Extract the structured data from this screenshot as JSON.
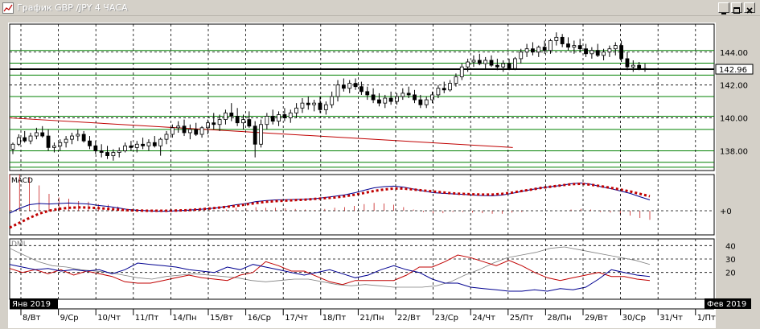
{
  "window": {
    "title": "График GBP /JPY  4 ЧАСА"
  },
  "colors": {
    "background": "#ffffff",
    "frame": "#d4d0c8",
    "grid": "#000000",
    "level": "#008000",
    "trendline": "#c00000",
    "macd_line": "#000090",
    "signal": "#c00000",
    "di_plus": "#000090",
    "di_minus": "#c00000",
    "adx": "#808080",
    "price_tag_bg": "#ffffff"
  },
  "chart_data": [
    {
      "type": "candlestick",
      "title": "GBP/JPY 4H",
      "ylim": [
        136.8,
        145.7
      ],
      "y_ticks": [
        "144.00",
        "142.00",
        "140.00",
        "138.00"
      ],
      "current_price_label": "142.96",
      "levels": [
        144.1,
        143.33,
        142.96,
        142.6,
        141.3,
        140.1,
        139.3,
        138.0,
        137.3,
        137.0
      ],
      "trendline": [
        [
          0,
          140.0
        ],
        [
          87,
          138.2
        ]
      ],
      "ohlc": [
        [
          138.1,
          138.5,
          137.8,
          138.4
        ],
        [
          138.4,
          139.0,
          138.3,
          138.8
        ],
        [
          138.8,
          139.2,
          138.5,
          138.6
        ],
        [
          138.6,
          139.1,
          138.4,
          138.9
        ],
        [
          138.9,
          139.4,
          138.7,
          139.1
        ],
        [
          139.1,
          139.5,
          138.8,
          138.9
        ],
        [
          138.9,
          139.3,
          138.0,
          138.2
        ],
        [
          138.2,
          138.5,
          137.9,
          138.3
        ],
        [
          138.3,
          138.7,
          138.0,
          138.5
        ],
        [
          138.5,
          138.9,
          138.2,
          138.7
        ],
        [
          138.7,
          139.1,
          138.4,
          138.9
        ],
        [
          138.9,
          139.3,
          138.6,
          139.0
        ],
        [
          139.0,
          139.2,
          138.5,
          138.6
        ],
        [
          138.6,
          138.9,
          138.1,
          138.3
        ],
        [
          138.3,
          138.6,
          137.8,
          138.0
        ],
        [
          138.0,
          138.4,
          137.6,
          137.9
        ],
        [
          137.9,
          138.3,
          137.5,
          137.7
        ],
        [
          137.7,
          138.1,
          137.4,
          137.9
        ],
        [
          137.9,
          138.2,
          137.6,
          138.0
        ],
        [
          138.0,
          138.5,
          137.9,
          138.3
        ],
        [
          138.3,
          138.6,
          138.0,
          138.2
        ],
        [
          138.2,
          138.6,
          137.9,
          138.4
        ],
        [
          138.4,
          138.8,
          138.1,
          138.3
        ],
        [
          138.3,
          138.7,
          138.0,
          138.5
        ],
        [
          138.5,
          138.9,
          138.2,
          138.3
        ],
        [
          138.3,
          138.8,
          137.7,
          138.7
        ],
        [
          138.7,
          139.2,
          138.4,
          139.0
        ],
        [
          139.0,
          139.6,
          138.8,
          139.4
        ],
        [
          139.4,
          139.8,
          139.1,
          139.5
        ],
        [
          139.5,
          139.9,
          138.9,
          139.1
        ],
        [
          139.1,
          139.6,
          138.7,
          139.3
        ],
        [
          139.3,
          139.7,
          138.9,
          139.0
        ],
        [
          139.0,
          139.5,
          138.8,
          139.4
        ],
        [
          139.4,
          139.9,
          139.0,
          139.7
        ],
        [
          139.7,
          140.3,
          139.3,
          139.6
        ],
        [
          139.6,
          140.2,
          139.2,
          139.9
        ],
        [
          139.9,
          140.5,
          139.6,
          140.3
        ],
        [
          140.3,
          140.9,
          139.8,
          140.1
        ],
        [
          140.1,
          140.6,
          139.5,
          139.7
        ],
        [
          139.7,
          140.2,
          139.3,
          139.9
        ],
        [
          139.9,
          140.4,
          139.4,
          139.5
        ],
        [
          139.5,
          139.8,
          137.6,
          138.4
        ],
        [
          138.4,
          139.9,
          138.2,
          139.6
        ],
        [
          139.6,
          140.3,
          139.3,
          140.1
        ],
        [
          140.1,
          140.5,
          139.6,
          139.8
        ],
        [
          139.8,
          140.4,
          139.5,
          140.2
        ],
        [
          140.2,
          140.6,
          139.8,
          140.0
        ],
        [
          140.0,
          140.5,
          139.7,
          140.3
        ],
        [
          140.3,
          140.9,
          140.0,
          140.6
        ],
        [
          140.6,
          141.2,
          140.3,
          140.9
        ],
        [
          140.9,
          141.3,
          140.5,
          140.8
        ],
        [
          140.8,
          141.1,
          140.4,
          140.9
        ],
        [
          140.9,
          141.3,
          140.3,
          140.5
        ],
        [
          140.5,
          141.0,
          140.2,
          140.8
        ],
        [
          140.8,
          141.6,
          140.6,
          141.3
        ],
        [
          141.3,
          142.3,
          141.0,
          142.0
        ],
        [
          142.0,
          142.4,
          141.6,
          141.8
        ],
        [
          141.8,
          142.3,
          141.5,
          142.1
        ],
        [
          142.1,
          142.4,
          141.7,
          141.9
        ],
        [
          141.9,
          142.2,
          141.4,
          141.6
        ],
        [
          141.6,
          141.9,
          141.1,
          141.4
        ],
        [
          141.4,
          141.8,
          140.9,
          141.1
        ],
        [
          141.1,
          141.5,
          140.7,
          140.9
        ],
        [
          140.9,
          141.4,
          140.6,
          141.2
        ],
        [
          141.2,
          141.6,
          140.8,
          141.0
        ],
        [
          141.0,
          141.5,
          140.8,
          141.3
        ],
        [
          141.3,
          141.8,
          141.1,
          141.5
        ],
        [
          141.5,
          141.9,
          141.2,
          141.4
        ],
        [
          141.4,
          141.7,
          140.9,
          141.1
        ],
        [
          141.1,
          141.4,
          140.6,
          140.8
        ],
        [
          140.8,
          141.3,
          140.6,
          141.1
        ],
        [
          141.1,
          141.6,
          140.9,
          141.4
        ],
        [
          141.4,
          142.0,
          141.2,
          141.8
        ],
        [
          141.8,
          142.2,
          141.5,
          141.7
        ],
        [
          141.7,
          142.3,
          141.6,
          142.1
        ],
        [
          142.1,
          142.7,
          141.9,
          142.5
        ],
        [
          142.5,
          143.3,
          142.3,
          143.1
        ],
        [
          143.1,
          143.6,
          142.8,
          143.4
        ],
        [
          143.4,
          143.8,
          143.1,
          143.5
        ],
        [
          143.5,
          143.9,
          143.2,
          143.3
        ],
        [
          143.3,
          143.7,
          143.0,
          143.5
        ],
        [
          143.5,
          143.8,
          143.1,
          143.2
        ],
        [
          143.2,
          143.6,
          142.9,
          143.1
        ],
        [
          143.1,
          143.5,
          142.8,
          143.3
        ],
        [
          143.3,
          143.6,
          142.9,
          143.0
        ],
        [
          143.0,
          143.7,
          142.9,
          143.6
        ],
        [
          143.6,
          144.2,
          143.3,
          144.0
        ],
        [
          144.0,
          144.5,
          143.7,
          144.2
        ],
        [
          144.2,
          144.6,
          143.8,
          144.0
        ],
        [
          144.0,
          144.4,
          143.7,
          144.3
        ],
        [
          144.3,
          144.7,
          143.9,
          144.1
        ],
        [
          144.1,
          144.8,
          143.9,
          144.7
        ],
        [
          144.7,
          145.2,
          144.4,
          144.9
        ],
        [
          144.9,
          145.1,
          144.3,
          144.5
        ],
        [
          144.5,
          144.9,
          144.1,
          144.3
        ],
        [
          144.3,
          144.7,
          143.9,
          144.4
        ],
        [
          144.4,
          144.8,
          144.0,
          144.2
        ],
        [
          144.2,
          144.5,
          143.7,
          143.9
        ],
        [
          143.9,
          144.3,
          143.6,
          144.1
        ],
        [
          144.1,
          144.5,
          143.7,
          143.8
        ],
        [
          143.8,
          144.2,
          143.5,
          144.0
        ],
        [
          144.0,
          144.4,
          143.7,
          144.2
        ],
        [
          144.2,
          144.6,
          143.8,
          144.4
        ],
        [
          144.4,
          144.7,
          143.4,
          143.6
        ],
        [
          143.6,
          144.0,
          142.9,
          143.1
        ],
        [
          143.1,
          143.5,
          142.8,
          143.2
        ],
        [
          143.2,
          143.4,
          142.9,
          143.0
        ],
        [
          143.0,
          143.3,
          142.8,
          142.96
        ]
      ]
    },
    {
      "type": "line",
      "title": "MACD",
      "y_tick": "+0",
      "ylim": [
        -1.0,
        1.5
      ],
      "series": [
        {
          "values": [
            -0.1,
            0.1,
            0.25,
            0.3,
            0.28,
            0.3,
            0.32,
            0.3,
            0.28,
            0.22,
            0.18,
            0.12,
            0.05,
            0.02,
            0.0,
            -0.02,
            -0.02,
            0.0,
            0.02,
            0.05,
            0.08,
            0.12,
            0.18,
            0.25,
            0.3,
            0.38,
            0.42,
            0.45,
            0.46,
            0.47,
            0.48,
            0.5,
            0.55,
            0.6,
            0.66,
            0.74,
            0.85,
            0.95,
            1.0,
            1.02,
            0.98,
            0.9,
            0.82,
            0.75,
            0.72,
            0.7,
            0.68,
            0.65,
            0.63,
            0.62,
            0.65,
            0.72,
            0.8,
            0.88,
            0.95,
            1.0,
            1.05,
            1.12,
            1.15,
            1.1,
            1.0,
            0.92,
            0.82,
            0.72,
            0.58,
            0.45
          ]
        },
        {
          "values": [
            -0.7,
            -0.5,
            -0.3,
            -0.12,
            0.0,
            0.08,
            0.12,
            0.14,
            0.13,
            0.11,
            0.08,
            0.05,
            0.02,
            0.01,
            0.0,
            0.0,
            0.0,
            0.01,
            0.02,
            0.05,
            0.08,
            0.12,
            0.16,
            0.2,
            0.26,
            0.32,
            0.37,
            0.4,
            0.42,
            0.44,
            0.46,
            0.49,
            0.52,
            0.55,
            0.6,
            0.66,
            0.74,
            0.82,
            0.88,
            0.92,
            0.92,
            0.88,
            0.84,
            0.8,
            0.76,
            0.72,
            0.7,
            0.68,
            0.67,
            0.67,
            0.7,
            0.75,
            0.82,
            0.88,
            0.95,
            1.0,
            1.05,
            1.1,
            1.12,
            1.08,
            1.02,
            0.95,
            0.88,
            0.8,
            0.7,
            0.6
          ]
        }
      ]
    },
    {
      "type": "line",
      "title": "DMI",
      "ylim": [
        0,
        45
      ],
      "y_ticks": [
        "40",
        "30",
        "20"
      ],
      "series": [
        {
          "values": [
            26,
            24,
            22,
            23,
            21,
            22,
            21,
            22,
            19,
            22,
            27,
            26,
            25,
            24,
            22,
            21,
            20,
            24,
            22,
            26,
            24,
            22,
            20,
            18,
            20,
            22,
            19,
            16,
            18,
            22,
            25,
            22,
            20,
            15,
            12,
            12,
            9,
            8,
            7,
            6,
            6,
            7,
            6,
            8,
            7,
            9,
            15,
            22,
            20,
            18,
            17
          ]
        },
        {
          "values": [
            23,
            20,
            22,
            19,
            22,
            18,
            21,
            19,
            17,
            13,
            12,
            12,
            14,
            16,
            18,
            16,
            15,
            14,
            18,
            20,
            28,
            25,
            21,
            21,
            17,
            13,
            11,
            14,
            14,
            14,
            14,
            18,
            24,
            24,
            28,
            33,
            31,
            28,
            25,
            29,
            25,
            20,
            16,
            14,
            16,
            18,
            20,
            17,
            17,
            15,
            14
          ]
        },
        {
          "values": [
            38,
            33,
            28,
            25,
            24,
            22,
            21,
            20,
            18,
            16,
            15,
            17,
            18,
            19,
            18,
            17,
            16,
            14,
            13,
            14,
            15,
            15,
            13,
            11,
            10,
            11,
            10,
            9,
            9,
            9,
            10,
            13,
            18,
            22,
            27,
            31,
            33,
            35,
            38,
            39,
            37,
            35,
            33,
            31,
            29,
            26
          ]
        }
      ]
    }
  ],
  "x_axis": {
    "labels": [
      "8/Вт",
      "9/Ср",
      "10/Чт",
      "11/Пт",
      "14/Пн",
      "15/Вт",
      "16/Ср",
      "17/Чт",
      "18/Пт",
      "21/Пн",
      "22/Вт",
      "23/Ср",
      "24/Чт",
      "25/Пт",
      "28/Пн",
      "29/Вт",
      "30/Ср",
      "31/Чт",
      "1/Пт"
    ],
    "left_month": "Янв 2019",
    "right_month": "Фев 2019"
  }
}
